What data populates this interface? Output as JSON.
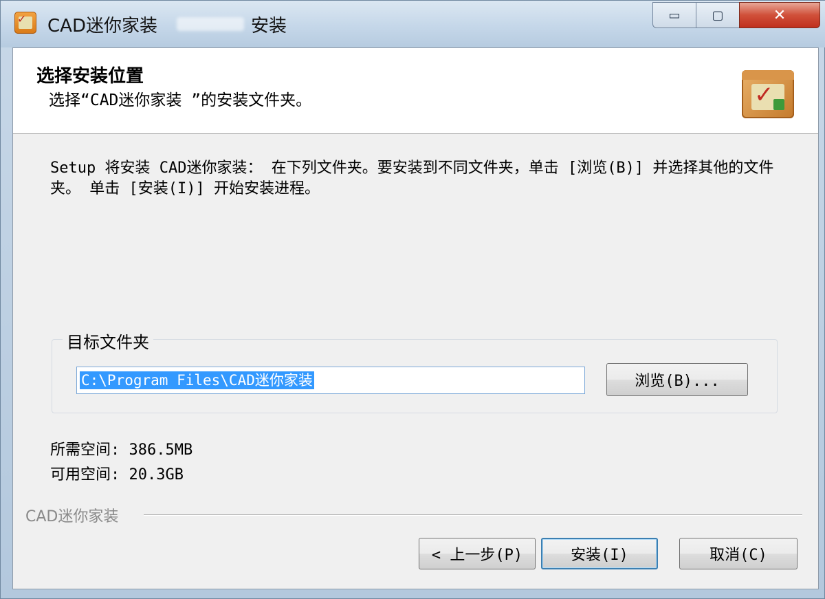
{
  "window": {
    "title_app": "CAD迷你家装",
    "title_suffix": "安装",
    "controls": {
      "minimize": "▭",
      "maximize": "▢",
      "close": "✕"
    }
  },
  "header": {
    "title": "选择安装位置",
    "subtitle": "选择“CAD迷你家装      ”的安装文件夹。"
  },
  "intro_text": "Setup 将安装 CAD迷你家装：     在下列文件夹。要安装到不同文件夹，单击 [浏览(B)] 并选择其他的文件夹。 单击 [安装(I)] 开始安装进程。",
  "destination": {
    "group_label": "目标文件夹",
    "path_value": "C:\\Program Files\\CAD迷你家装",
    "browse_label": "浏览(B)..."
  },
  "space": {
    "required": "所需空间: 386.5MB",
    "available": "可用空间: 20.3GB"
  },
  "footer": {
    "brand": "CAD迷你家装",
    "back_label": "< 上一步(P)",
    "install_label": "安装(I)",
    "cancel_label": "取消(C)"
  },
  "icons": {
    "app": "cad-app-icon",
    "header": "package-box-icon"
  },
  "colors": {
    "selection": "#3399ff",
    "close_button": "#c0301e",
    "title_bar": "#c5d7e9"
  }
}
